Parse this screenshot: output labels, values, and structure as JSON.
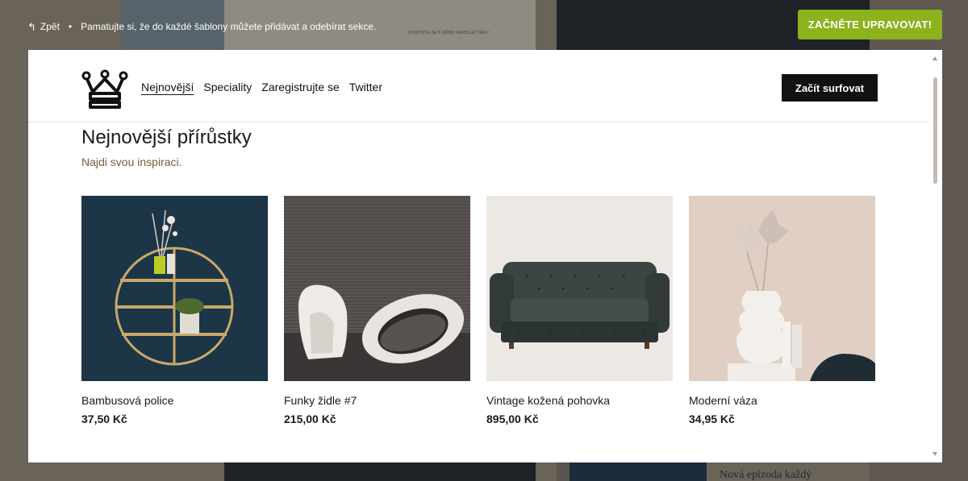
{
  "topbar": {
    "back_label": "Zpět",
    "notice": "Pamatujte si, že do každé šablony můžete přidávat a odebírat sekce.",
    "cta_label": "ZAČNĚTE UPRAVOVAT!"
  },
  "background": {
    "newsletter_text": "PODPIŠTE SE K MÉMU NEWSLETTERU",
    "episode_text": "Nová epizoda každý"
  },
  "site": {
    "nav": [
      "Nejnovější",
      "Speciality",
      "Zaregistrujte se",
      "Twitter"
    ],
    "cta_label": "Začít surfovat",
    "heading": "Nejnovější přírůstky",
    "subheading": "Najdi svou inspiraci."
  },
  "products": [
    {
      "name": "Bambusová police",
      "price": "37,50 Kč"
    },
    {
      "name": "Funky židle #7",
      "price": "215,00 Kč"
    },
    {
      "name": "Vintage kožená pohovka",
      "price": "895,00 Kč"
    },
    {
      "name": "Moderní váza",
      "price": "34,95 Kč"
    }
  ],
  "colors": {
    "accent": "#8cb21d",
    "overlay_bg": "#5a534e",
    "subheading": "#7a5a3a"
  }
}
